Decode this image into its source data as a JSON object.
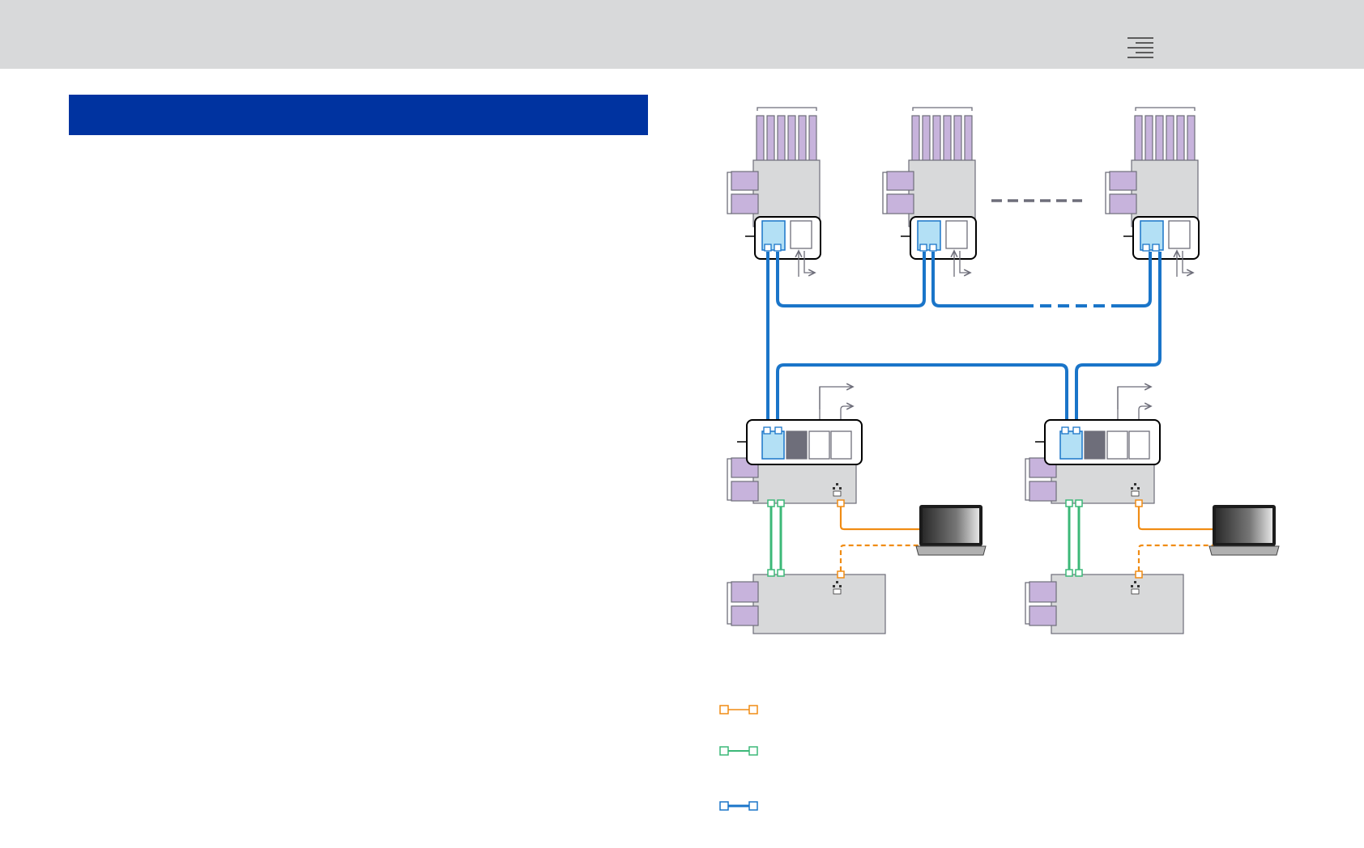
{
  "header": {
    "menu_icon": "menu-icon",
    "background": "#d8d9da"
  },
  "section_title_bar": {
    "color": "#0033a0"
  },
  "colors": {
    "blue_link": "#1a75c9",
    "green_link": "#3cb878",
    "orange_link": "#f08c14",
    "purple_card": "#c7b3dc",
    "chassis_gray": "#d8d9da",
    "gray_line": "#6e6e7a"
  },
  "legend": {
    "items": [
      {
        "icon": "orange-link-icon",
        "color": "#f08c14"
      },
      {
        "icon": "green-link-icon",
        "color": "#3cb878"
      },
      {
        "icon": "blue-link-icon",
        "color": "#1a75c9"
      }
    ]
  }
}
